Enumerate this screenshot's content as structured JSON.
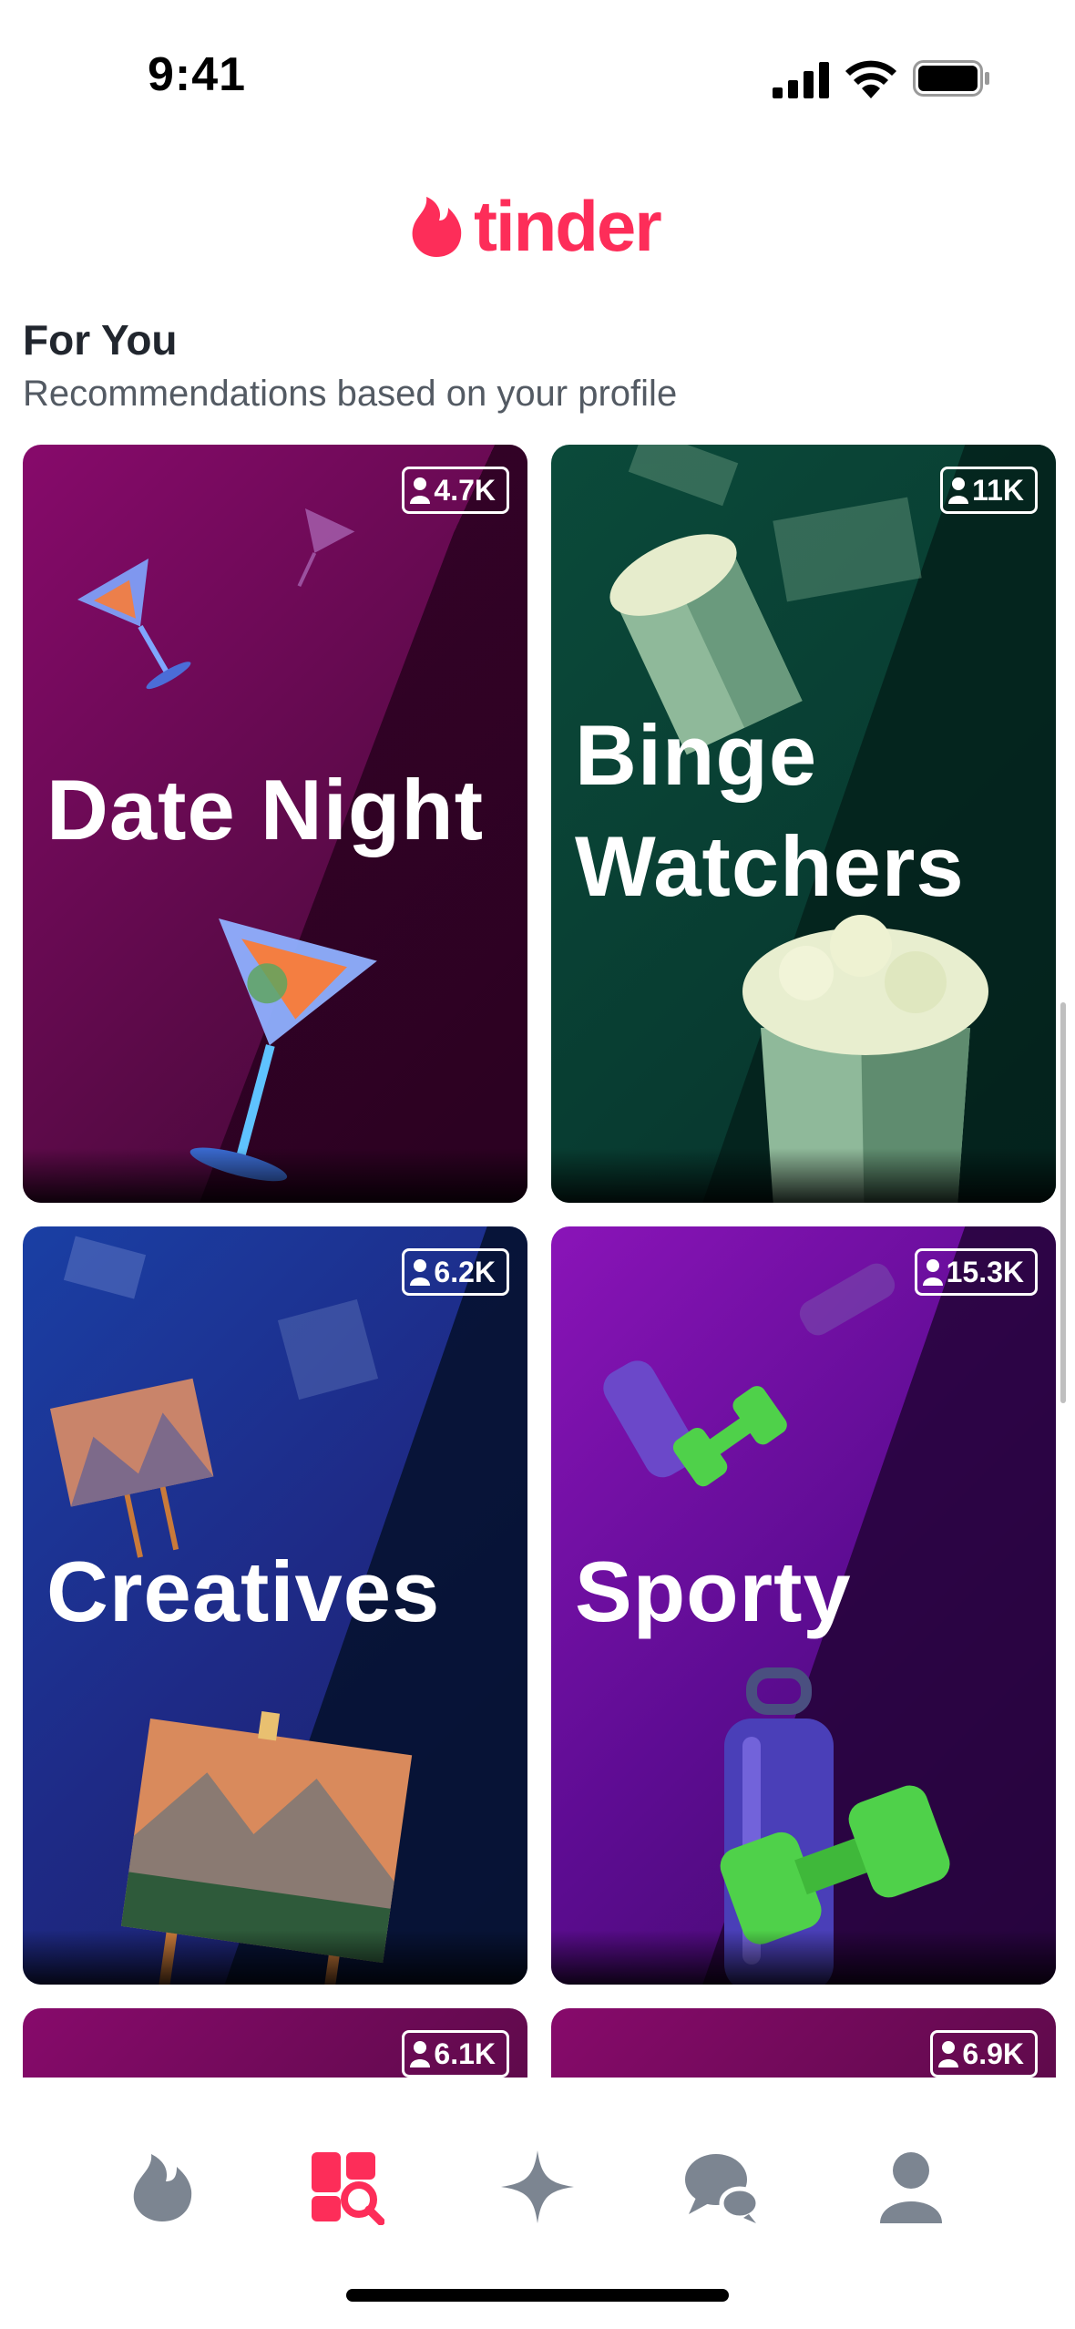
{
  "status_bar": {
    "time": "9:41",
    "icons": [
      "signal-icon",
      "wifi-icon",
      "battery-icon"
    ]
  },
  "header": {
    "logo_text": "tinder",
    "brand_color": "#fd2d59"
  },
  "section": {
    "title": "For You",
    "subtitle": "Recommendations based on your profile"
  },
  "cards": [
    {
      "title": "Date Night",
      "count": "4.7K",
      "icon": "martini-glass-icon"
    },
    {
      "title": "Binge\nWatchers",
      "count": "11K",
      "icon": "popcorn-icon"
    },
    {
      "title": "Creatives",
      "count": "6.2K",
      "icon": "easel-painting-icon"
    },
    {
      "title": "Sporty",
      "count": "15.3K",
      "icon": "water-bottle-dumbbell-icon"
    },
    {
      "title": "",
      "count": "6.1K"
    },
    {
      "title": "",
      "count": "6.9K"
    }
  ],
  "tab_bar": {
    "active_tab": "explore",
    "tabs": [
      "home-flame-icon",
      "explore-icon",
      "gold-sparkle-icon",
      "chat-icon",
      "profile-icon"
    ],
    "active_color": "#fd2d59",
    "inactive_color": "#7c8591"
  }
}
